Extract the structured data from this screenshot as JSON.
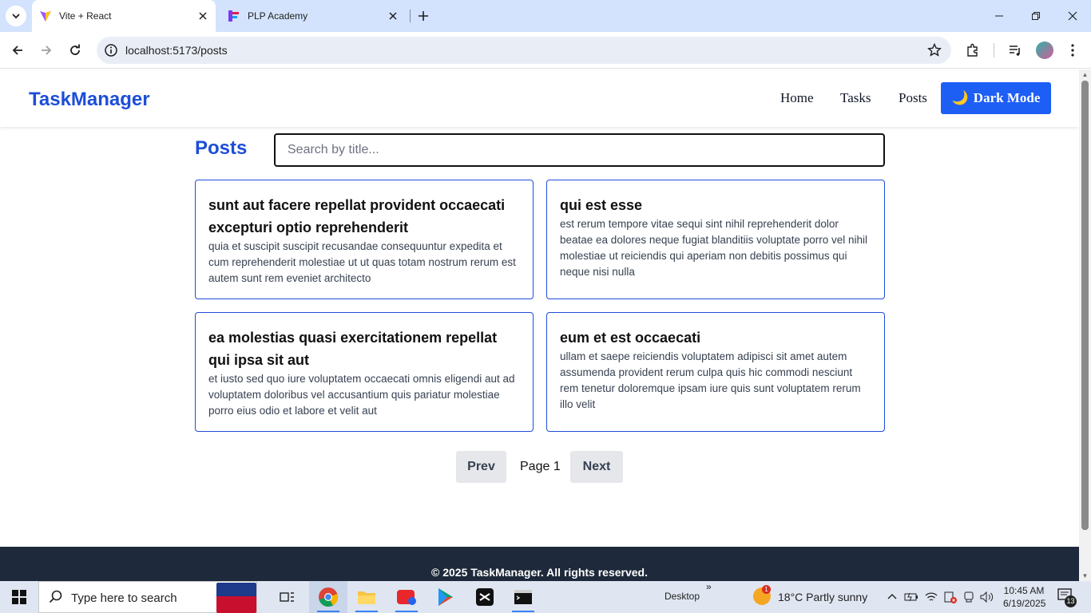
{
  "browser": {
    "tabs": [
      {
        "title": "Vite + React",
        "active": true
      },
      {
        "title": "PLP Academy",
        "active": false
      }
    ],
    "url": "localhost:5173/posts"
  },
  "app": {
    "brand": "TaskManager",
    "nav": [
      "Home",
      "Tasks",
      "Posts"
    ],
    "dark_mode_emoji": "🌙",
    "dark_mode_label": "Dark Mode",
    "accent_color": "#1d4ed8"
  },
  "posts_page": {
    "title": "Posts",
    "search_placeholder": "Search by title...",
    "posts": [
      {
        "title": "sunt aut facere repellat provident occaecati excepturi optio reprehenderit",
        "body": "quia et suscipit suscipit recusandae consequuntur expedita et cum reprehenderit molestiae ut ut quas totam nostrum rerum est autem sunt rem eveniet architecto"
      },
      {
        "title": "qui est esse",
        "body": "est rerum tempore vitae sequi sint nihil reprehenderit dolor beatae ea dolores neque fugiat blanditiis voluptate porro vel nihil molestiae ut reiciendis qui aperiam non debitis possimus qui neque nisi nulla"
      },
      {
        "title": "ea molestias quasi exercitationem repellat qui ipsa sit aut",
        "body": "et iusto sed quo iure voluptatem occaecati omnis eligendi aut ad voluptatem doloribus vel accusantium quis pariatur molestiae porro eius odio et labore et velit aut"
      },
      {
        "title": "eum et est occaecati",
        "body": "ullam et saepe reiciendis voluptatem adipisci sit amet autem assumenda provident rerum culpa quis hic commodi nesciunt rem tenetur doloremque ipsam iure quis sunt voluptatem rerum illo velit"
      }
    ],
    "pagination": {
      "prev": "Prev",
      "page_label": "Page 1",
      "next": "Next"
    }
  },
  "footer": {
    "text": "© 2025 TaskManager. All rights reserved."
  },
  "taskbar": {
    "search_text": "Type here to search",
    "desktop_label": "Desktop",
    "desktop_chevron": "»",
    "weather": "18°C  Partly sunny",
    "weather_badge": "1",
    "time": "10:45 AM",
    "date": "6/19/2025",
    "notification_count": "13"
  }
}
